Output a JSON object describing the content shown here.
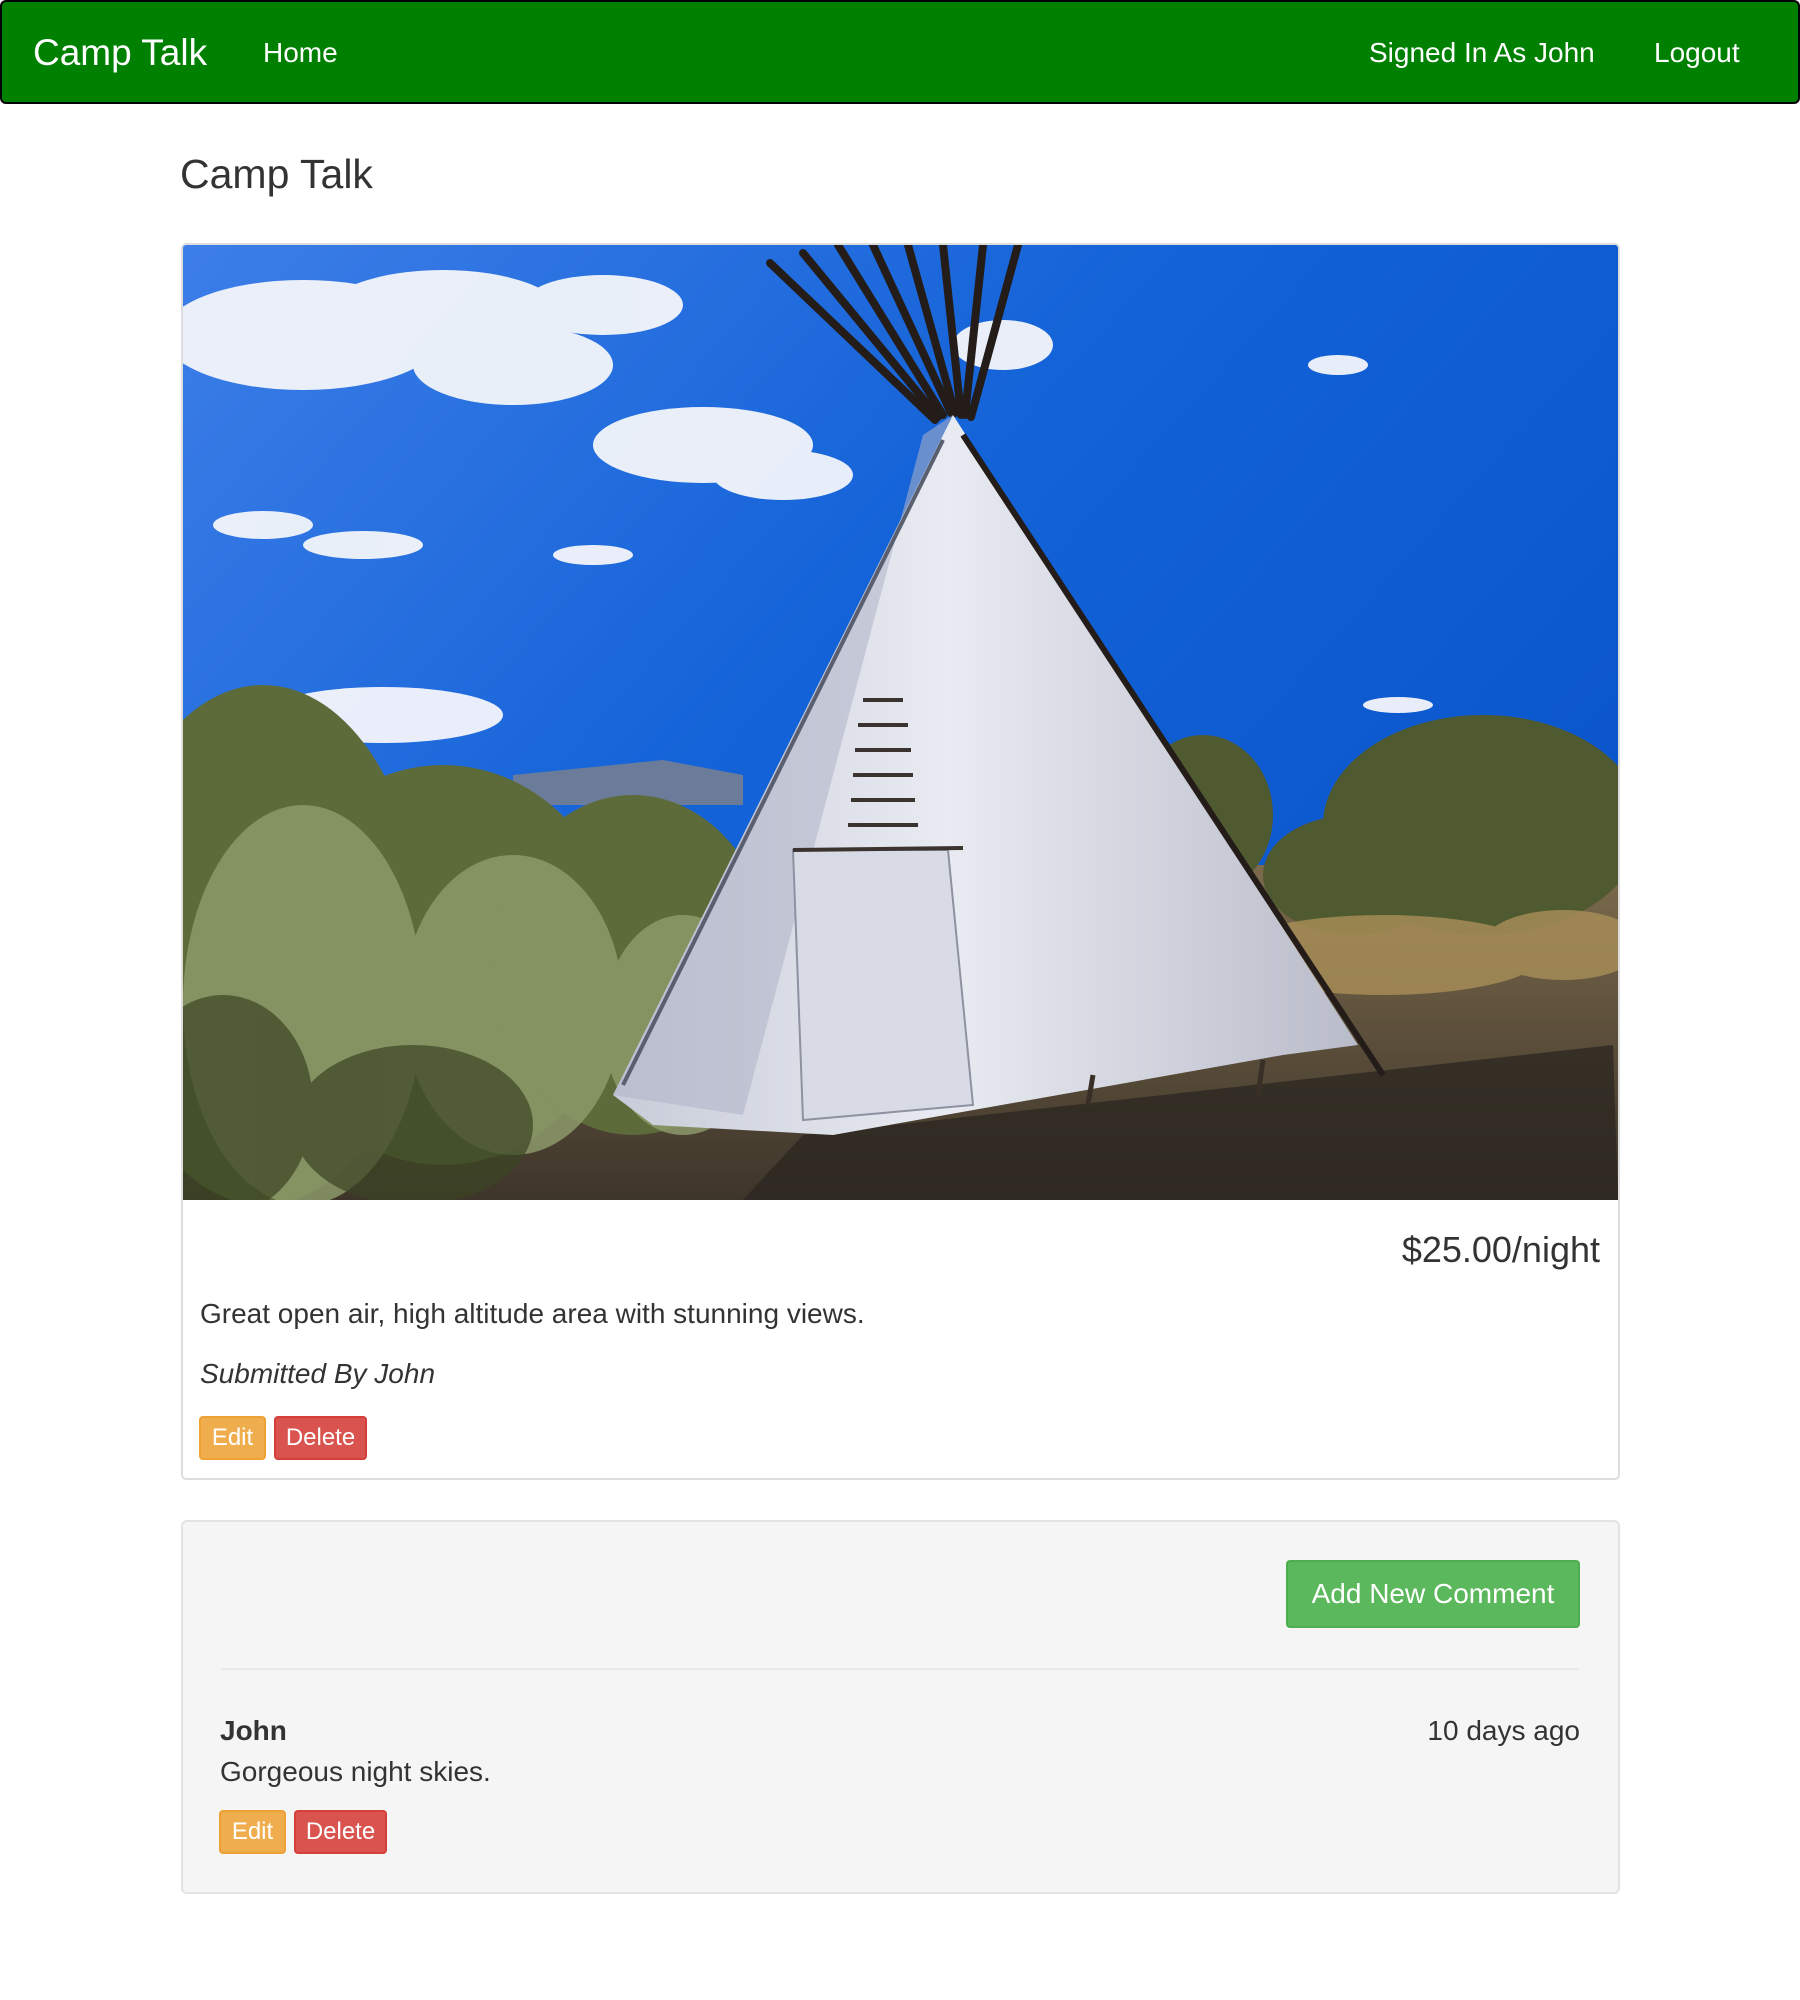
{
  "navbar": {
    "brand": "Camp Talk",
    "home_link": "Home",
    "signed_in_text": "Signed In As John",
    "logout_link": "Logout"
  },
  "page": {
    "title": "Camp Talk"
  },
  "campground": {
    "price": "$25.00/night",
    "description": "Great open air, high altitude area with stunning views.",
    "submitted_by": "Submitted By John",
    "edit_label": "Edit",
    "delete_label": "Delete"
  },
  "comments_section": {
    "add_comment_label": "Add New Comment",
    "comments": [
      {
        "author": "John",
        "time": "10 days ago",
        "text": "Gorgeous night skies.",
        "edit_label": "Edit",
        "delete_label": "Delete"
      }
    ]
  },
  "colors": {
    "navbar_bg": "#008000",
    "warning": "#f0ad4e",
    "danger": "#d9534f",
    "success": "#5cb85c"
  }
}
